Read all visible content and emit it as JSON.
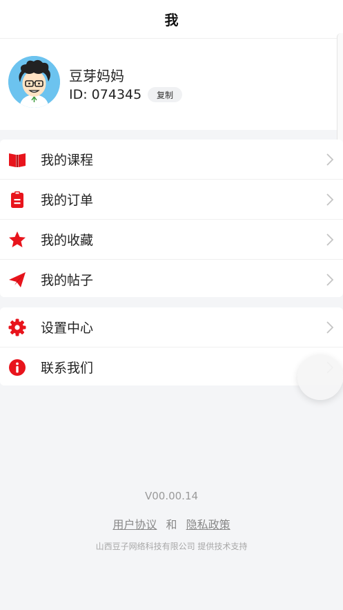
{
  "header": {
    "title": "我"
  },
  "profile": {
    "name": "豆芽妈妈",
    "id_text": "ID: 074345",
    "copy_label": "复制"
  },
  "menu_group_1": [
    {
      "label": "我的课程",
      "icon": "book-icon"
    },
    {
      "label": "我的订单",
      "icon": "clipboard-icon"
    },
    {
      "label": "我的收藏",
      "icon": "star-icon"
    },
    {
      "label": "我的帖子",
      "icon": "paper-plane-icon"
    }
  ],
  "menu_group_2": [
    {
      "label": "设置中心",
      "icon": "gear-icon"
    },
    {
      "label": "联系我们",
      "icon": "info-icon"
    }
  ],
  "footer": {
    "version": "V00.00.14",
    "user_agreement": "用户协议",
    "and": "和",
    "privacy_policy": "隐私政策",
    "company": "山西豆子网络科技有限公司 提供技术支持"
  },
  "colors": {
    "accent": "#e8141c",
    "background": "#f4f5f7",
    "card": "#ffffff"
  }
}
